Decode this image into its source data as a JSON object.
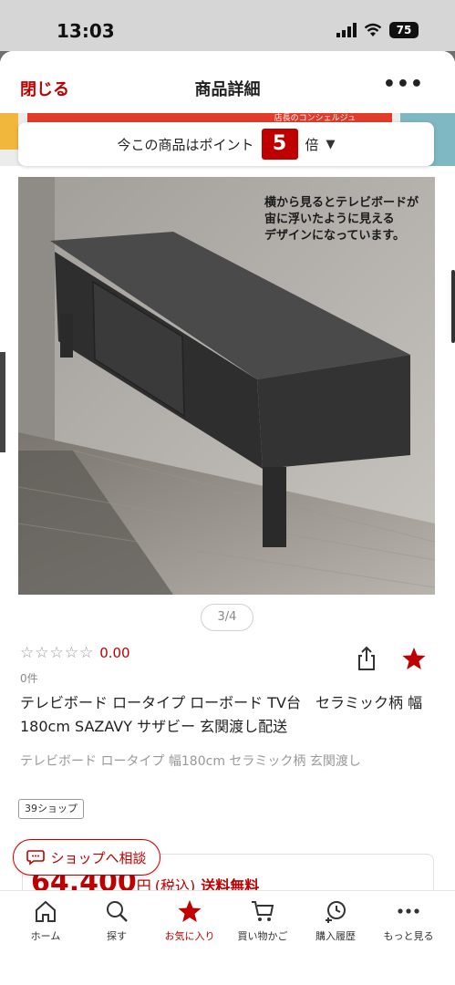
{
  "status_bar": {
    "time": "13:03",
    "battery": "75"
  },
  "nav": {
    "close_label": "閉じる",
    "title": "商品詳細",
    "more_label": "•••"
  },
  "banner": {
    "strip_text": "店長のコンシェルジュ"
  },
  "points": {
    "prefix": "今この商品はポイント",
    "multiplier": "5",
    "suffix": "倍"
  },
  "image": {
    "caption_lines": [
      "横から見るとテレビボードが",
      "宙に浮いたように見える",
      "デザインになっています。"
    ],
    "pager": "3/4"
  },
  "rating": {
    "stars": "☆☆☆☆☆",
    "score": "0.00",
    "review_count": "0件"
  },
  "product": {
    "title": "テレビボード ロータイプ ローボード TV台　セラミック柄 幅180cm SAZAVY サザビー 玄関渡し配送",
    "subtitle": "テレビボード ロータイプ 幅180cm セラミック柄 玄関渡し",
    "shop_tag": "39ショップ"
  },
  "consult": {
    "label": "ショップへ相談"
  },
  "price": {
    "amount": "64,400",
    "unit": "円",
    "tax": "(税込)",
    "shipping": "送料無料"
  },
  "tabbar": {
    "items": [
      {
        "label": "ホーム",
        "icon": "home-icon",
        "active": false
      },
      {
        "label": "探す",
        "icon": "search-icon",
        "active": false
      },
      {
        "label": "お気に入り",
        "icon": "star-icon",
        "active": true
      },
      {
        "label": "買い物かご",
        "icon": "cart-icon",
        "active": false
      },
      {
        "label": "購入履歴",
        "icon": "history-icon",
        "active": false
      },
      {
        "label": "もっと見る",
        "icon": "more-icon",
        "active": false
      }
    ]
  },
  "colors": {
    "accent": "#bf0000",
    "text": "#222222",
    "muted": "#999999"
  }
}
